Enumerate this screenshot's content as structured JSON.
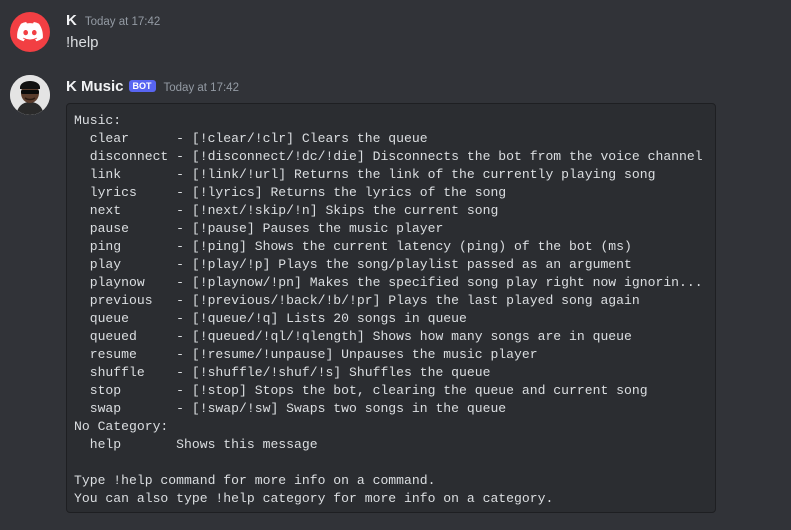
{
  "messages": [
    {
      "author": "K",
      "timestamp": "Today at 17:42",
      "avatar_icon": "discord-logo-icon",
      "avatar_color": "#f23f43",
      "content": "!help"
    },
    {
      "author": "K Music",
      "bot_tag": "BOT",
      "timestamp": "Today at 17:42",
      "avatar_icon": "bot-avatar-icon",
      "code_block": "Music:\n  clear      - [!clear/!clr] Clears the queue\n  disconnect - [!disconnect/!dc/!die] Disconnects the bot from the voice channel\n  link       - [!link/!url] Returns the link of the currently playing song\n  lyrics     - [!lyrics] Returns the lyrics of the song\n  next       - [!next/!skip/!n] Skips the current song\n  pause      - [!pause] Pauses the music player\n  ping       - [!ping] Shows the current latency (ping) of the bot (ms)\n  play       - [!play/!p] Plays the song/playlist passed as an argument\n  playnow    - [!playnow/!pn] Makes the specified song play right now ignorin...\n  previous   - [!previous/!back/!b/!pr] Plays the last played song again\n  queue      - [!queue/!q] Lists 20 songs in queue\n  queued     - [!queued/!ql/!qlength] Shows how many songs are in queue\n  resume     - [!resume/!unpause] Unpauses the music player\n  shuffle    - [!shuffle/!shuf/!s] Shuffles the queue\n  stop       - [!stop] Stops the bot, clearing the queue and current song\n  swap       - [!swap/!sw] Swaps two songs in the queue\nNo Category:\n  help       Shows this message\n\nType !help command for more info on a command.\nYou can also type !help category for more info on a category."
    }
  ],
  "colors": {
    "background": "#313338",
    "codeblock_bg": "#2b2d31",
    "bot_tag": "#5865f2",
    "username": "#f2f3f5",
    "timestamp": "#949ba4"
  }
}
